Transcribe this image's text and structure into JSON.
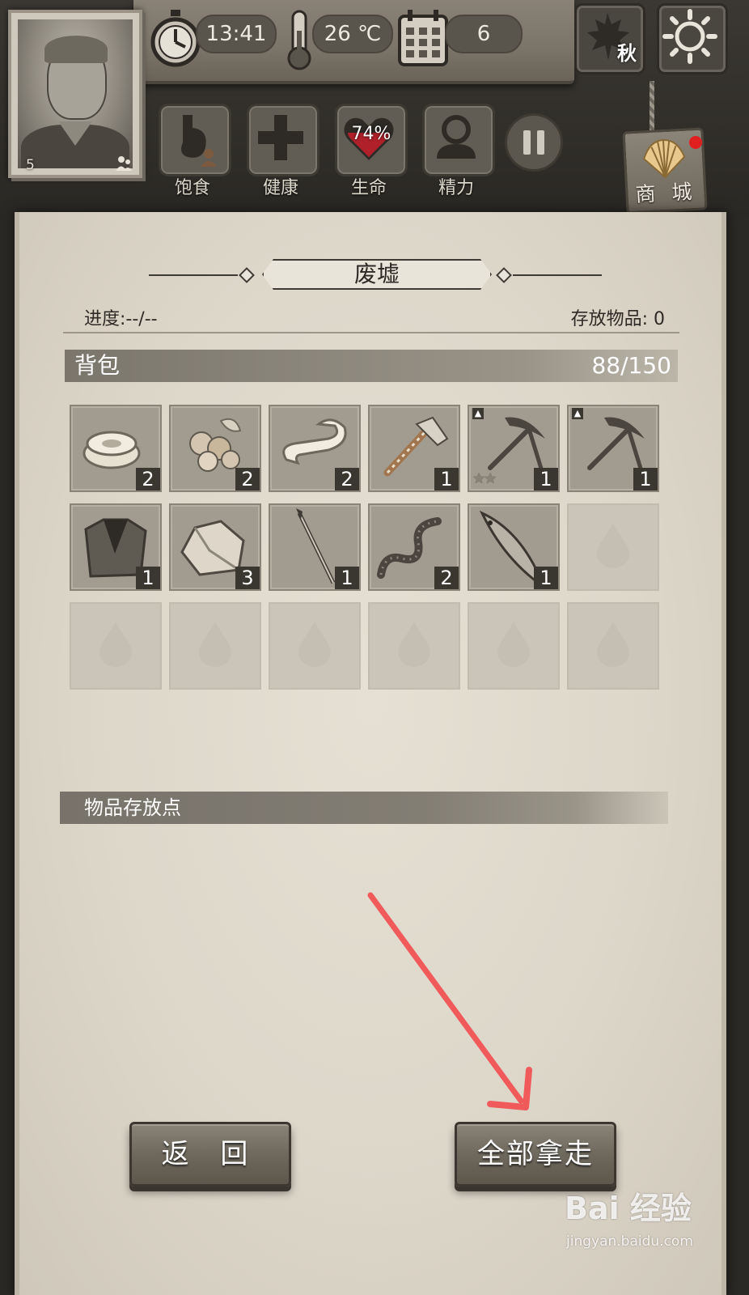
{
  "hud": {
    "level": "5",
    "time": "13:41",
    "temperature": "26 ℃",
    "day": "6",
    "season": "秋",
    "status": [
      {
        "label": "饱食"
      },
      {
        "label": "健康"
      },
      {
        "label": "生命",
        "value": "74%"
      },
      {
        "label": "精力"
      }
    ],
    "shop_label": "商 城"
  },
  "panel": {
    "title": "废墟",
    "progress": "进度:--/--",
    "stored": "存放物品: 0",
    "backpack_title": "背包",
    "backpack_count": "88/150",
    "storage_title": "物品存放点"
  },
  "inventory": {
    "items": [
      {
        "icon": "bandage-roll-icon",
        "qty": "2"
      },
      {
        "icon": "berries-icon",
        "qty": "2"
      },
      {
        "icon": "cloth-strip-icon",
        "qty": "2"
      },
      {
        "icon": "axe-icon",
        "qty": "1"
      },
      {
        "icon": "pickaxe-icon",
        "qty": "1",
        "stars": "★★",
        "upgrade": true
      },
      {
        "icon": "pickaxe-icon",
        "qty": "1",
        "upgrade": true
      },
      {
        "icon": "cloth-shirt-icon",
        "qty": "1"
      },
      {
        "icon": "stone-icon",
        "qty": "3"
      },
      {
        "icon": "spear-icon",
        "qty": "1"
      },
      {
        "icon": "worm-icon",
        "qty": "2"
      },
      {
        "icon": "fish-icon",
        "qty": "1"
      }
    ],
    "total_slots": 18
  },
  "buttons": {
    "back": "返 回",
    "take_all": "全部拿走"
  },
  "watermark": {
    "brand": "Bai 经验",
    "url": "jingyan.baidu.com"
  },
  "colors": {
    "parchment": "#ddd7ca",
    "annotation_arrow": "#f05a5a",
    "notification_dot": "#e02020"
  }
}
